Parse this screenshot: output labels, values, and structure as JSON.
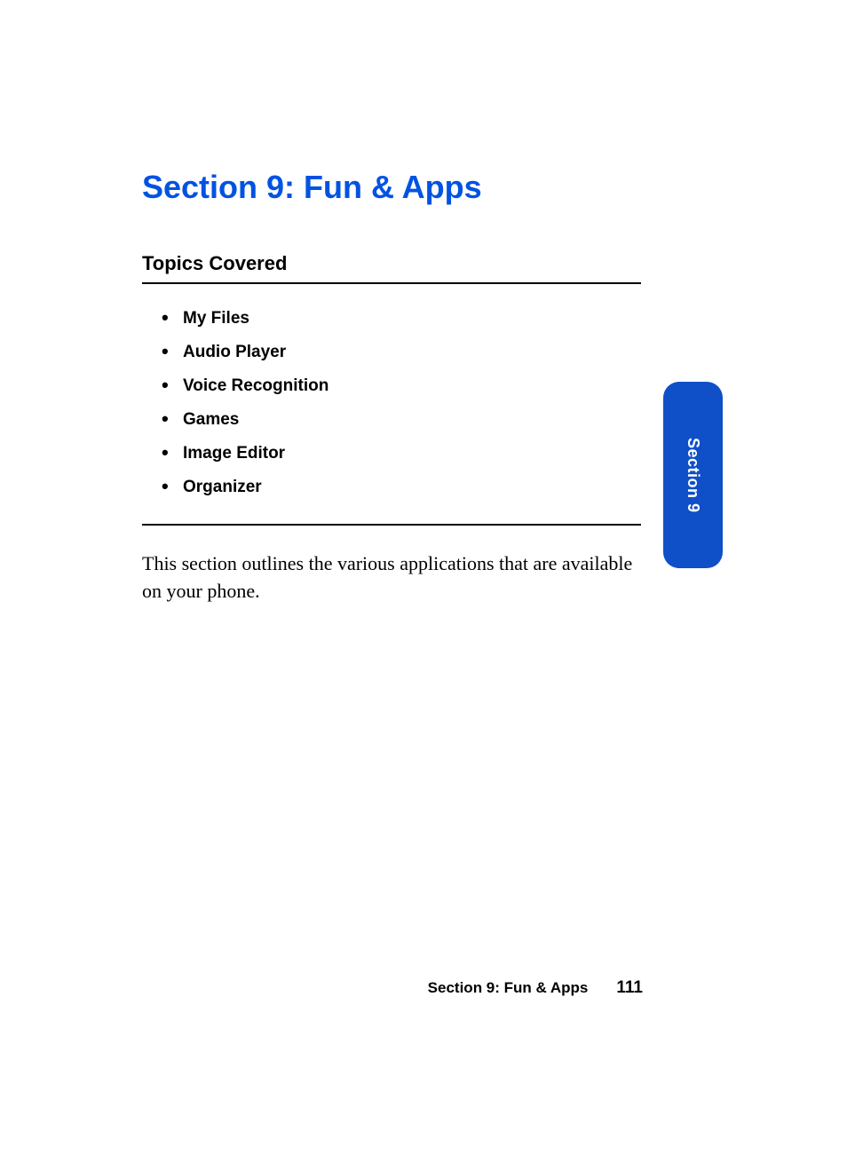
{
  "section_title": "Section 9: Fun & Apps",
  "topics_heading": "Topics Covered",
  "topics": [
    "My Files",
    "Audio Player",
    "Voice Recognition",
    "Games",
    "Image Editor",
    "Organizer"
  ],
  "body_text": "This section outlines the various applications that are available on your phone.",
  "side_tab": "Section 9",
  "footer": {
    "section_label": "Section 9: Fun & Apps",
    "page_number": "111"
  }
}
